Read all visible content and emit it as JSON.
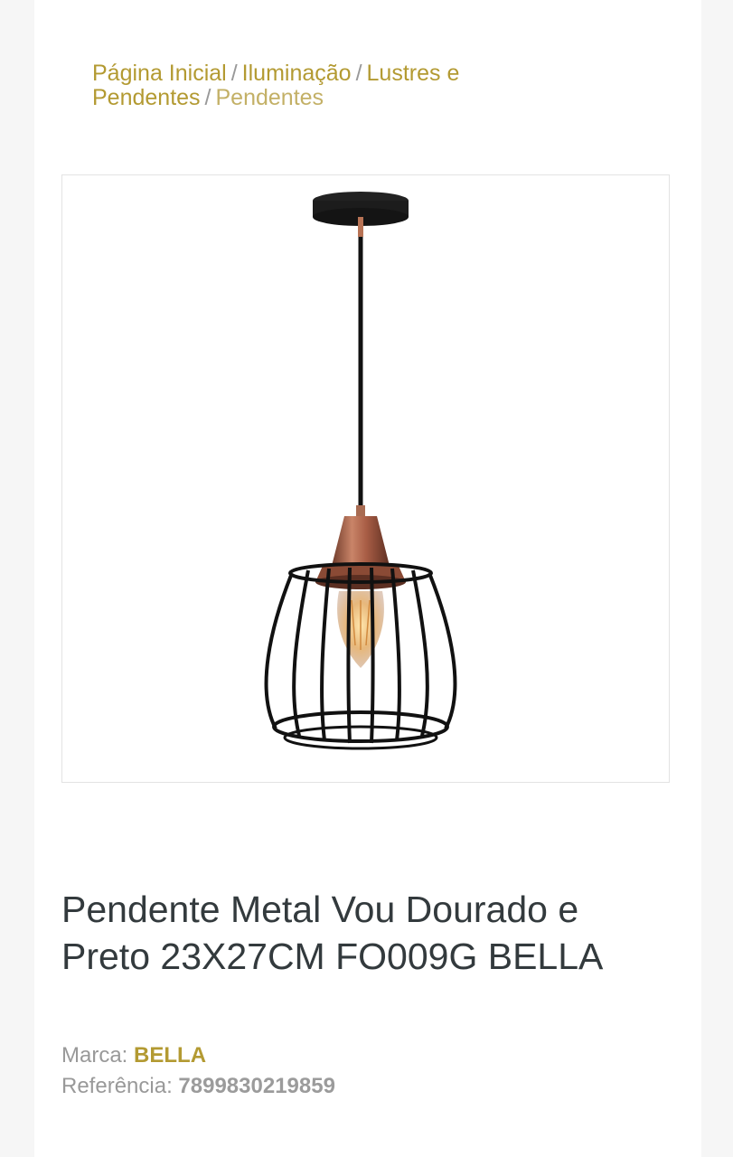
{
  "breadcrumb": {
    "items": [
      {
        "label": "Página Inicial"
      },
      {
        "label": "Iluminação"
      },
      {
        "label": "Lustres e Pendentes"
      },
      {
        "label": "Pendentes"
      }
    ],
    "separator": "/"
  },
  "product": {
    "image_alt": "pendant-lamp-product-image",
    "title_line1": "Pendente Metal Vou Dourado e",
    "title_line2": "Preto 23X27CM FO009G BELLA",
    "brand_label": "Marca:",
    "brand_value": "BELLA",
    "reference_label": "Referência:",
    "reference_value": "7899830219859"
  },
  "colors": {
    "accent": "#b39a32",
    "muted": "#999999",
    "title": "#333a3d",
    "copper": "#b06a4e",
    "black_metal": "#1a1a1a"
  }
}
